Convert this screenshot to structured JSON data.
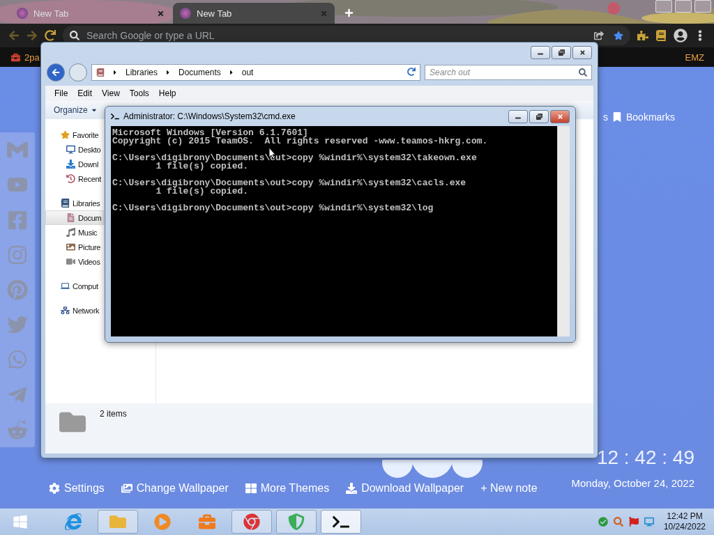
{
  "browser": {
    "tabs": [
      {
        "label": "New Tab",
        "selected": false
      },
      {
        "label": "New Tab",
        "selected": true
      }
    ],
    "omnibox": {
      "placeholder": "Search Google or type a URL"
    },
    "bookmarks_bar": {
      "left": "2pa",
      "right": "EMZ"
    }
  },
  "new_tab_page": {
    "top_links": [
      {
        "label": "s"
      },
      {
        "label": "Bookmarks",
        "kind": "bookmark"
      }
    ],
    "clock": "12 : 42 : 49",
    "date": "Monday, October 24, 2022",
    "links": [
      {
        "label": "Settings",
        "kind": "settings"
      },
      {
        "label": "Change Wallpaper",
        "kind": "wallpaper"
      },
      {
        "label": "More Themes",
        "kind": "themes"
      },
      {
        "label": "Download Wallpaper",
        "kind": "download"
      },
      {
        "label": "+ New note"
      }
    ]
  },
  "explorer": {
    "breadcrumbs": [
      "Libraries",
      "Documents",
      "out"
    ],
    "search": {
      "placeholder": "Search out"
    },
    "menu": [
      "File",
      "Edit",
      "View",
      "Tools",
      "Help"
    ],
    "toolbar": [
      "Organize"
    ],
    "nav": [
      {
        "label": "Favorite",
        "kind": "favorites",
        "selected": false,
        "children": [
          {
            "label": "Deskto",
            "kind": "desktop",
            "selected": false
          },
          {
            "label": "Downl",
            "kind": "downloads",
            "selected": false
          },
          {
            "label": "Recent",
            "kind": "recent",
            "selected": false
          }
        ]
      },
      {
        "label": "Libraries",
        "kind": "libraries",
        "selected": false,
        "children": [
          {
            "label": "Docum",
            "kind": "documents",
            "selected": true
          },
          {
            "label": "Music",
            "kind": "music",
            "selected": false
          },
          {
            "label": "Picture",
            "kind": "pictures",
            "selected": false
          },
          {
            "label": "Videos",
            "kind": "videos",
            "selected": false
          }
        ]
      },
      {
        "label": "Comput",
        "kind": "computer",
        "selected": false
      },
      {
        "label": "Network",
        "kind": "network",
        "selected": false
      }
    ],
    "status": "2 items"
  },
  "console": {
    "title": "Administrator: C:\\Windows\\System32\\cmd.exe",
    "blocks": [
      [
        "Microsoft Windows [Version 6.1.7601]",
        "Copyright (c) 2015 TeamOS.  All rights reserved -www.teamos-hkrg.com."
      ],
      [
        "C:\\Users\\digibrony\\Documents\\out>copy %windir%\\system32\\takeown.exe",
        "        1 file(s) copied."
      ],
      [
        "C:\\Users\\digibrony\\Documents\\out>copy %windir%\\system32\\cacls.exe",
        "        1 file(s) copied."
      ],
      [
        "C:\\Users\\digibrony\\Documents\\out>copy %windir%\\system32\\log"
      ]
    ]
  },
  "taskbar": {
    "apps": [
      {
        "kind": "ie",
        "open": false,
        "selected": false
      },
      {
        "kind": "explorer",
        "open": true,
        "selected": false
      },
      {
        "kind": "media",
        "open": false,
        "selected": false
      },
      {
        "kind": "uc",
        "open": false,
        "selected": false
      },
      {
        "kind": "chrome",
        "open": true,
        "selected": false
      },
      {
        "kind": "shield",
        "open": true,
        "selected": false
      },
      {
        "kind": "cmd",
        "open": true,
        "selected": true
      }
    ],
    "time": "12:42 PM",
    "date": "10/24/2022"
  }
}
